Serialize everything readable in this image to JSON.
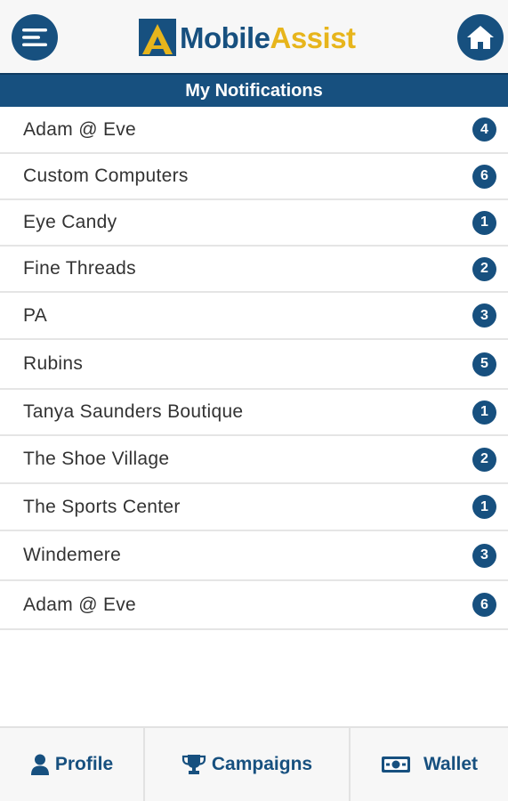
{
  "header": {
    "menu_icon": "hamburger-menu-icon",
    "home_icon": "home-icon",
    "logo_word1": "Mobile",
    "logo_word2": "Assist"
  },
  "page_title": "My Notifications",
  "notifications": [
    {
      "name": "Adam @ Eve",
      "count": "4"
    },
    {
      "name": "Custom Computers",
      "count": "6"
    },
    {
      "name": "Eye Candy",
      "count": "1"
    },
    {
      "name": "Fine Threads",
      "count": "2"
    },
    {
      "name": "PA",
      "count": "3"
    },
    {
      "name": "Rubins",
      "count": "5"
    },
    {
      "name": "Tanya Saunders Boutique",
      "count": "1"
    },
    {
      "name": "The Shoe Village",
      "count": "2"
    },
    {
      "name": "The Sports Center",
      "count": "1"
    },
    {
      "name": "Windemere",
      "count": "3"
    },
    {
      "name": "Adam @ Eve",
      "count": "6"
    }
  ],
  "bottom_nav": {
    "profile_label": "Profile",
    "campaigns_label": "Campaigns",
    "wallet_label": "Wallet",
    "profile_icon": "user-icon",
    "campaigns_icon": "trophy-icon",
    "wallet_icon": "money-icon"
  },
  "colors": {
    "primary": "#17507f",
    "accent": "#e7b51c"
  }
}
